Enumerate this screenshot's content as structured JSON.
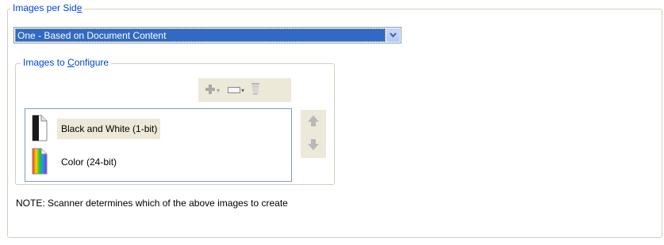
{
  "images_per_side": {
    "legend": "Images per Side",
    "legend_pre": "Images per Sid",
    "legend_mnemonic": "e",
    "legend_post": "",
    "selected_value": "One - Based on Document Content"
  },
  "images_to_configure": {
    "legend": "Images to Configure",
    "legend_pre": "Images to ",
    "legend_mnemonic": "C",
    "legend_post": "onfigure",
    "toolbar": {
      "icons": [
        "add-icon",
        "image-size-icon",
        "delete-icon"
      ]
    },
    "items": [
      {
        "label": "Black and White (1-bit)",
        "icon": "black-white-document-icon",
        "selected": true
      },
      {
        "label": "Color (24-bit)",
        "icon": "color-document-icon",
        "selected": false
      }
    ],
    "move_buttons": [
      "move-up-icon",
      "move-down-icon"
    ]
  },
  "note": "NOTE: Scanner determines which of the above images to create",
  "colors": {
    "legend_text": "#0046d5",
    "selection": "#316ac5",
    "face": "#ece9d8",
    "border": "#7f9db9"
  }
}
